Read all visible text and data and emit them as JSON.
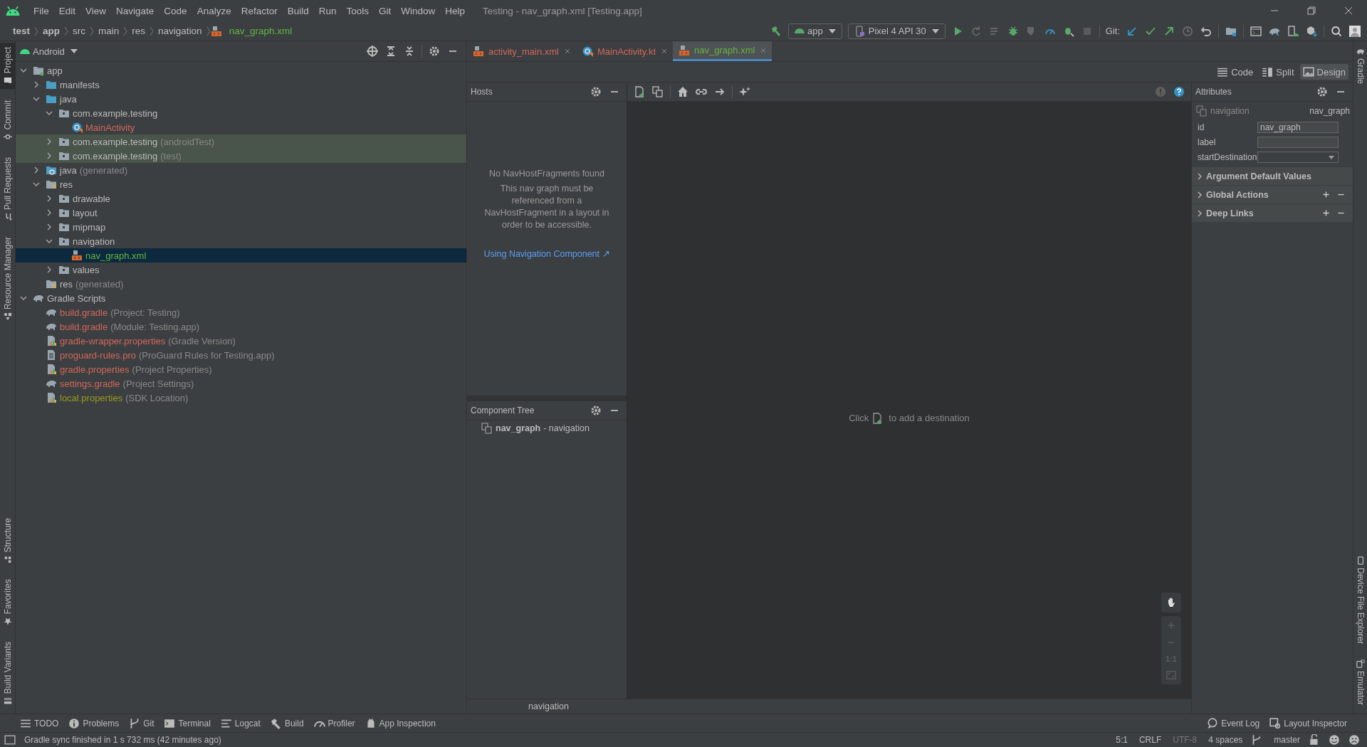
{
  "window": {
    "title": "Testing - nav_graph.xml [Testing.app]"
  },
  "menu": [
    "File",
    "Edit",
    "View",
    "Navigate",
    "Code",
    "Analyze",
    "Refactor",
    "Build",
    "Run",
    "Tools",
    "Git",
    "Window",
    "Help"
  ],
  "breadcrumbs": [
    {
      "label": "test",
      "kind": "module"
    },
    {
      "label": "app",
      "kind": "module"
    },
    {
      "label": "src",
      "kind": "folder"
    },
    {
      "label": "main",
      "kind": "folder"
    },
    {
      "label": "res",
      "kind": "folder"
    },
    {
      "label": "navigation",
      "kind": "folder"
    },
    {
      "label": "nav_graph.xml",
      "kind": "file",
      "color": "#62b543"
    }
  ],
  "toolbar": {
    "run_config": "app",
    "device": "Pixel 4 API 30",
    "git_label": "Git:"
  },
  "left_stripe": {
    "top": [
      {
        "label": "Project",
        "selected": true
      },
      {
        "label": "Commit",
        "selected": false
      },
      {
        "label": "Pull Requests",
        "selected": false
      },
      {
        "label": "Resource Manager",
        "selected": false
      }
    ],
    "bottom": [
      {
        "label": "Structure",
        "selected": false
      },
      {
        "label": "Favorites",
        "selected": false
      },
      {
        "label": "Build Variants",
        "selected": false
      }
    ]
  },
  "right_stripe": {
    "top": [
      {
        "label": "Gradle",
        "selected": false
      }
    ],
    "bottom": [
      {
        "label": "Device File Explorer",
        "selected": false
      },
      {
        "label": "Emulator",
        "selected": false
      }
    ]
  },
  "project": {
    "view": "Android",
    "tree": [
      {
        "label": "app",
        "kind": "module",
        "expanded": true,
        "selected": false,
        "highlighted": false,
        "children": [
          {
            "label": "manifests",
            "kind": "source",
            "expanded": false,
            "selected": false,
            "highlighted": false
          },
          {
            "label": "java",
            "kind": "source",
            "expanded": true,
            "selected": false,
            "highlighted": false,
            "children": [
              {
                "label": "com.example.testing",
                "kind": "package",
                "expanded": true,
                "selected": false,
                "highlighted": false,
                "children": [
                  {
                    "label": "MainActivity",
                    "kind": "class",
                    "color": "#d1675a",
                    "selected": false,
                    "highlighted": false
                  }
                ]
              },
              {
                "label": "com.example.testing",
                "note": "(androidTest)",
                "kind": "package",
                "expanded": false,
                "selected": false,
                "highlighted": true
              },
              {
                "label": "com.example.testing",
                "note": "(test)",
                "kind": "package",
                "expanded": false,
                "selected": false,
                "highlighted": true
              }
            ]
          },
          {
            "label": "java",
            "note": "(generated)",
            "kind": "generated",
            "expanded": false,
            "selected": false,
            "highlighted": false
          },
          {
            "label": "res",
            "kind": "res",
            "expanded": true,
            "selected": false,
            "highlighted": false,
            "children": [
              {
                "label": "drawable",
                "kind": "package",
                "expanded": false,
                "selected": false,
                "highlighted": false
              },
              {
                "label": "layout",
                "kind": "package",
                "expanded": false,
                "selected": false,
                "highlighted": false
              },
              {
                "label": "mipmap",
                "kind": "package",
                "expanded": false,
                "selected": false,
                "highlighted": false
              },
              {
                "label": "navigation",
                "kind": "package",
                "expanded": true,
                "selected": false,
                "highlighted": false,
                "children": [
                  {
                    "label": "nav_graph.xml",
                    "kind": "nav",
                    "color": "#62b543",
                    "selected": true,
                    "highlighted": false
                  }
                ]
              },
              {
                "label": "values",
                "kind": "package",
                "expanded": false,
                "selected": false,
                "highlighted": false
              }
            ]
          },
          {
            "label": "res",
            "note": "(generated)",
            "kind": "res",
            "selected": false,
            "highlighted": false
          }
        ]
      },
      {
        "label": "Gradle Scripts",
        "kind": "gradle",
        "expanded": true,
        "selected": false,
        "highlighted": false,
        "children": [
          {
            "label": "build.gradle",
            "note": "(Project: Testing)",
            "kind": "gradle",
            "color": "#d1675a",
            "selected": false,
            "highlighted": false
          },
          {
            "label": "build.gradle",
            "note": "(Module: Testing.app)",
            "kind": "gradle",
            "color": "#d1675a",
            "selected": false,
            "highlighted": false
          },
          {
            "label": "gradle-wrapper.properties",
            "note": "(Gradle Version)",
            "kind": "properties",
            "color": "#d1675a",
            "selected": false,
            "highlighted": false
          },
          {
            "label": "proguard-rules.pro",
            "note": "(ProGuard Rules for Testing.app)",
            "kind": "text",
            "color": "#d1675a",
            "selected": false,
            "highlighted": false
          },
          {
            "label": "gradle.properties",
            "note": "(Project Properties)",
            "kind": "properties",
            "color": "#d1675a",
            "selected": false,
            "highlighted": false
          },
          {
            "label": "settings.gradle",
            "note": "(Project Settings)",
            "kind": "gradle",
            "color": "#d1675a",
            "selected": false,
            "highlighted": false
          },
          {
            "label": "local.properties",
            "note": "(SDK Location)",
            "kind": "properties",
            "color": "#9a9a20",
            "selected": false,
            "highlighted": false
          }
        ]
      }
    ]
  },
  "editor_tabs": [
    {
      "label": "activity_main.xml",
      "kind": "nav",
      "color": "#d1675a",
      "selected": false
    },
    {
      "label": "MainActivity.kt",
      "kind": "class",
      "color": "#d1675a",
      "selected": false
    },
    {
      "label": "nav_graph.xml",
      "kind": "nav",
      "color": "#62b543",
      "selected": true
    }
  ],
  "view_modes": [
    {
      "label": "Code",
      "selected": false
    },
    {
      "label": "Split",
      "selected": false
    },
    {
      "label": "Design",
      "selected": true
    }
  ],
  "hosts": {
    "title": "Hosts",
    "empty_title": "No NavHostFragments found",
    "empty_message": "This nav graph must be referenced from a NavHostFragment in a layout in order to be accessible.",
    "link": "Using Navigation Component ↗"
  },
  "component_tree": {
    "title": "Component Tree",
    "items": [
      {
        "name": "nav_graph",
        "suffix": "- navigation",
        "selected": false
      }
    ]
  },
  "canvas": {
    "hint_before": "Click",
    "hint_after": "to add a destination",
    "zoom_reset": "1:1"
  },
  "path_bar": "navigation",
  "attributes": {
    "title": "Attributes",
    "element_type": "navigation",
    "element_id": "nav_graph",
    "fields": [
      {
        "label": "id",
        "kind": "text",
        "value": "nav_graph"
      },
      {
        "label": "label",
        "kind": "text"
      },
      {
        "label": "startDestination",
        "kind": "dropdown"
      }
    ],
    "sections": [
      {
        "label": "Argument Default Values",
        "expanded": false,
        "can_add": false
      },
      {
        "label": "Global Actions",
        "expanded": false,
        "can_add": true
      },
      {
        "label": "Deep Links",
        "expanded": false,
        "can_add": true
      }
    ]
  },
  "tool_windows": {
    "left": [
      "TODO",
      "Problems",
      "Git",
      "Terminal",
      "Logcat",
      "Build",
      "Profiler",
      "App Inspection"
    ],
    "right": [
      "Event Log",
      "Layout Inspector"
    ]
  },
  "status_bar": {
    "message": "Gradle sync finished in 1 s 732 ms (42 minutes ago)",
    "items": [
      {
        "label": "5:1",
        "disabled": false
      },
      {
        "label": "CRLF",
        "disabled": false
      },
      {
        "label": "UTF-8",
        "disabled": true
      },
      {
        "label": "4 spaces",
        "disabled": false
      }
    ],
    "branch": "master"
  }
}
